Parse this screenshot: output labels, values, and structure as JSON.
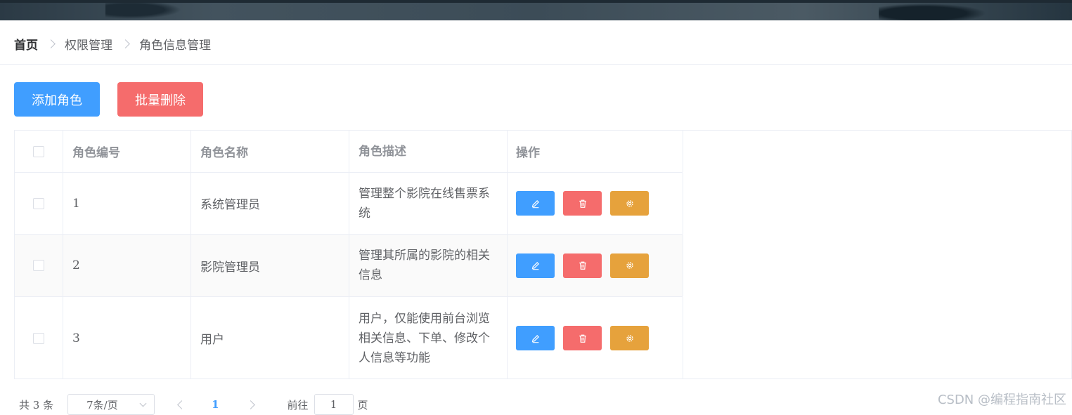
{
  "breadcrumb": [
    "首页",
    "权限管理",
    "角色信息管理"
  ],
  "toolbar": {
    "add_label": "添加角色",
    "batch_delete_label": "批量删除"
  },
  "colors": {
    "primary": "#409eff",
    "danger": "#f56c6c",
    "warning": "#e6a23c"
  },
  "table": {
    "headers": [
      "角色编号",
      "角色名称",
      "角色描述",
      "操作"
    ],
    "rows": [
      {
        "id": "1",
        "name": "系统管理员",
        "desc": "管理整个影院在线售票系统"
      },
      {
        "id": "2",
        "name": "影院管理员",
        "desc": "管理其所属的影院的相关信息"
      },
      {
        "id": "3",
        "name": "用户",
        "desc": "用户，仅能使用前台浏览相关信息、下单、修改个人信息等功能"
      }
    ],
    "row_actions": [
      "edit-icon",
      "delete-icon",
      "setting-icon"
    ]
  },
  "pagination": {
    "total": "共 3 条",
    "page_size": "7条/页",
    "current_page": "1",
    "goto_label": "前往",
    "goto_value": "1",
    "goto_suffix": "页"
  },
  "watermark": "CSDN @编程指南社区"
}
